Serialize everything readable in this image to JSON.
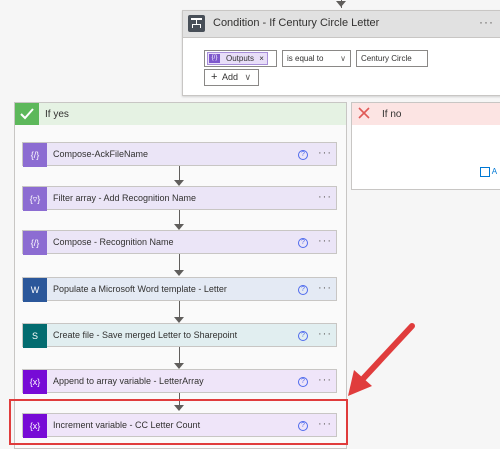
{
  "condition": {
    "title": "Condition - If Century Circle Letter",
    "token_label": "Outputs",
    "token_remove": "×",
    "operator": "is equal to",
    "operator_chevron": "∨",
    "value": "Century Circle",
    "add_label": "Add",
    "add_prefix": "+",
    "add_chevron": "∨",
    "more": "···"
  },
  "yes_branch": {
    "label": "If yes",
    "icon": "check-icon"
  },
  "no_branch": {
    "label": "If no",
    "icon": "close-icon",
    "add_action_partial": "A"
  },
  "actions": [
    {
      "title": "Compose-AckFileName",
      "icon": "compose-icon",
      "icon_text": "{/}",
      "help": "?",
      "more": "···"
    },
    {
      "title": "Filter array - Add Recognition Name",
      "icon": "filter-icon",
      "icon_text": "{▿}",
      "more": "···"
    },
    {
      "title": "Compose - Recognition Name",
      "icon": "compose-icon",
      "icon_text": "{/}",
      "help": "?",
      "more": "···"
    },
    {
      "title": "Populate a Microsoft Word template - Letter",
      "icon": "word-icon",
      "icon_text": "W",
      "help": "?",
      "more": "···"
    },
    {
      "title": "Create file - Save merged Letter to Sharepoint",
      "icon": "sharepoint-icon",
      "icon_text": "S",
      "help": "?",
      "more": "···"
    },
    {
      "title": "Append to array variable - LetterArray",
      "icon": "variable-icon",
      "icon_text": "{x}",
      "help": "?",
      "more": "···"
    },
    {
      "title": "Increment variable - CC Letter Count",
      "icon": "variable-icon",
      "icon_text": "{x}",
      "help": "?",
      "more": "···"
    }
  ],
  "colors": {
    "highlight": "#e03c3c",
    "yes": "#5db85b",
    "no": "#e05a57"
  }
}
